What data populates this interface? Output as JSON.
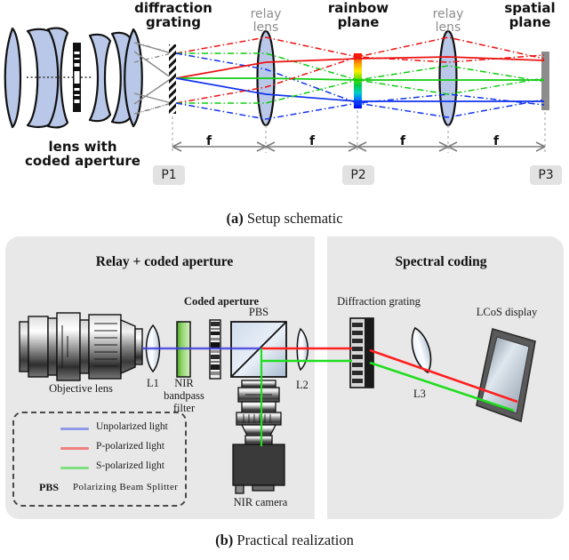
{
  "figure": {
    "panel_a": {
      "caption_label": "(a)",
      "caption_text": "Setup schematic",
      "labels": {
        "lens_coded_aperture": "lens with\ncoded aperture",
        "diffraction_grating": "diffraction\ngrating",
        "relay_lens_1": "relay\nlens",
        "rainbow_plane": "rainbow\nplane",
        "relay_lens_2": "relay\nlens",
        "spatial_plane": "spatial\nplane"
      },
      "distance_label": "f",
      "distances": [
        "f",
        "f",
        "f",
        "f"
      ],
      "plane_tags": [
        "P1",
        "P2",
        "P3"
      ],
      "ray_colors": {
        "red": "#ee1111",
        "green": "#11cc11",
        "blue": "#1133ee",
        "gray": "#8a8a8a"
      },
      "lens_fill": "#b9c8e8",
      "rainbow_stops": [
        "#ff0000",
        "#ff8800",
        "#ffee00",
        "#66dd00",
        "#00cc44",
        "#00cccc",
        "#0066ff",
        "#0000ee"
      ]
    },
    "panel_b": {
      "caption_label": "(b)",
      "caption_text": "Practical realization",
      "subpanels": [
        {
          "id": "relay",
          "title": "Relay + coded aperture"
        },
        {
          "id": "spectral",
          "title": "Spectral coding"
        }
      ],
      "components": {
        "objective_lens": "Objective lens",
        "l1": "L1",
        "nir_filter": "NIR\nbandpass\nfilter",
        "coded_aperture": "Coded aperture",
        "pbs": "PBS",
        "l2": "L2",
        "nir_camera": "NIR camera",
        "diffraction_grating": "Diffraction grating",
        "l3": "L3",
        "lcos_display": "LCoS display"
      },
      "legend": {
        "rows": [
          {
            "label": "Unpolarized light",
            "color": "#8f9ae8"
          },
          {
            "label": "P-polarized light",
            "color": "#f08080"
          },
          {
            "label": "S-polarized light",
            "color": "#7fe07f"
          }
        ],
        "abbr": "PBS",
        "abbr_expansion": "Polarizing  Beam  Splitter"
      },
      "beam_colors": {
        "unpolarized": "#4040e0",
        "p_polarized": "#ff2020",
        "s_polarized": "#20dd20"
      },
      "panel_bg": "#e8e8e8"
    }
  }
}
